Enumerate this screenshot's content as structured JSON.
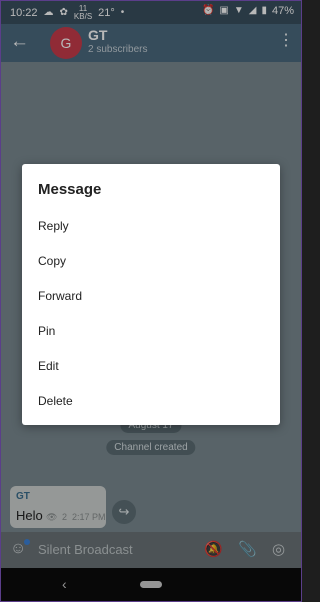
{
  "status_bar": {
    "time": "10:22",
    "speed_value": "11",
    "speed_unit": "KB/S",
    "temperature": "21°",
    "battery": "47%"
  },
  "header": {
    "avatar_letter": "G",
    "title": "GT",
    "subtitle": "2 subscribers"
  },
  "dialog": {
    "title": "Message",
    "items": [
      "Reply",
      "Copy",
      "Forward",
      "Pin",
      "Edit",
      "Delete"
    ]
  },
  "chat": {
    "date_pill": "August 17",
    "service_pill": "Channel created",
    "message": {
      "sender": "GT",
      "text": "Helo",
      "views": "2",
      "time": "2:17 PM"
    }
  },
  "input_bar": {
    "placeholder": "Silent Broadcast"
  },
  "icons": {
    "back": "back-arrow-icon",
    "more": "more-vert-icon",
    "emoji": "emoji-icon",
    "mute": "bell-off-icon",
    "attach": "paperclip-icon",
    "instagram": "instagram-icon",
    "share": "share-icon"
  }
}
